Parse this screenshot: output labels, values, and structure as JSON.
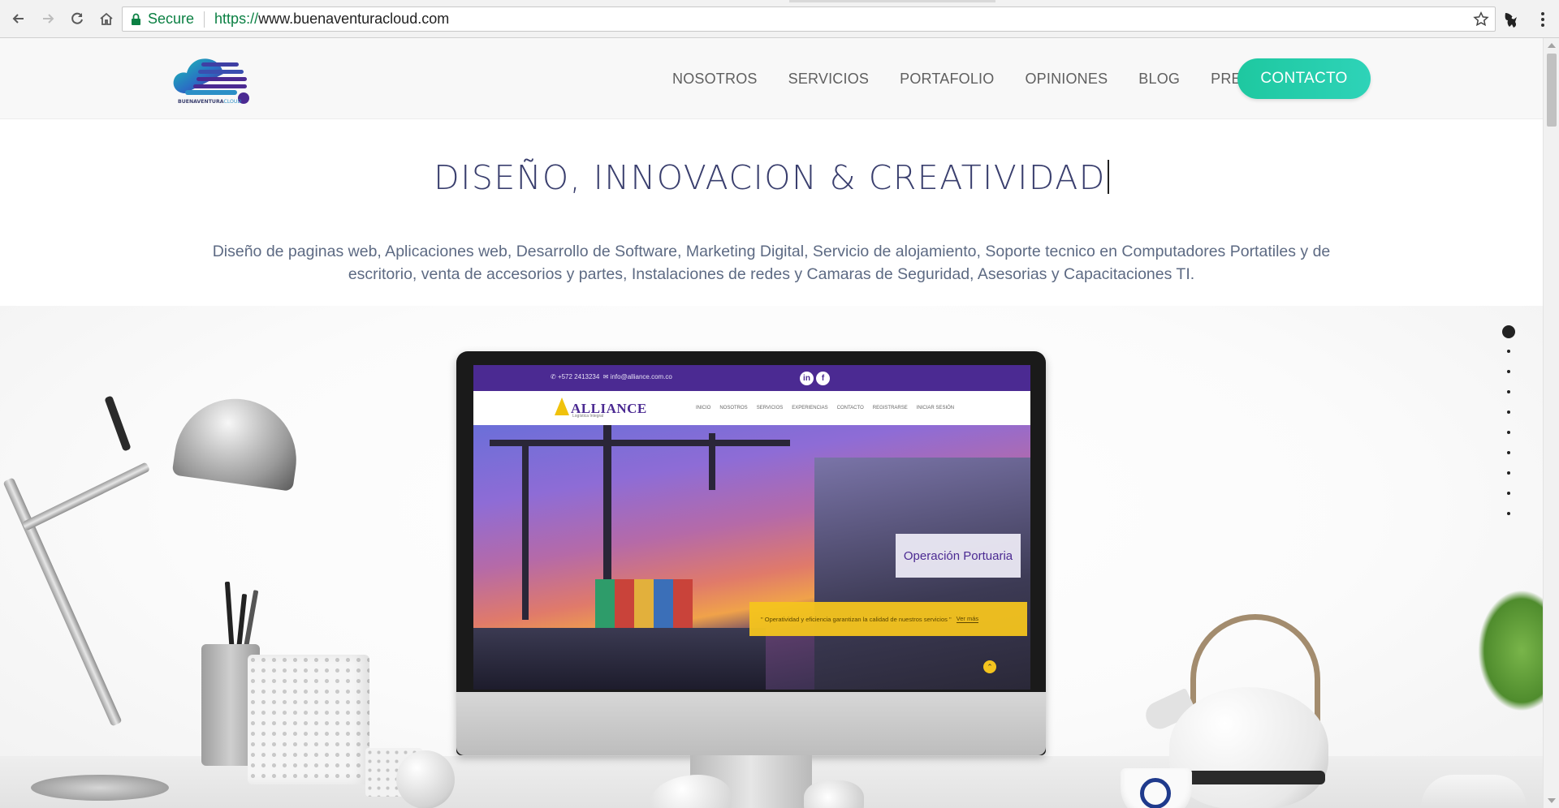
{
  "browser": {
    "secure_label": "Secure",
    "url_scheme": "https://",
    "url_rest": "www.buenaventuracloud.com",
    "icons": [
      "back-arrow-icon",
      "forward-arrow-icon",
      "reload-icon",
      "home-icon",
      "lock-icon",
      "star-icon",
      "extension-icon",
      "menu-icon"
    ]
  },
  "header": {
    "logo_text": "BUENAVENTURACLOUD",
    "nav": [
      "NOSOTROS",
      "SERVICIOS",
      "PORTAFOLIO",
      "OPINIONES",
      "BLOG",
      "PRECIOS"
    ],
    "contact_label": "CONTACTO",
    "accent_color": "#26cdae"
  },
  "hero": {
    "title": "DISEÑO, INNOVACION & CREATIVIDAD",
    "subtitle": "Diseño de paginas web, Aplicaciones web, Desarrollo de Software, Marketing Digital, Servicio de alojamiento, Soporte tecnico en Computadores Portatiles y de escritorio, venta de accesorios y partes, Instalaciones de redes y Camaras de Seguridad, Asesorias y Capacitaciones TI."
  },
  "monitor_screen": {
    "topbar_phone": "+572 2413234",
    "topbar_email": "info@alliance.com.co",
    "social": [
      "in",
      "f"
    ],
    "brand": "ALLIANCE",
    "brand_sub": "Logística Integral",
    "nav": [
      "INICIO",
      "NOSOTROS",
      "SERVICIOS",
      "EXPERIENCIAS",
      "CONTACTO",
      "REGISTRARSE",
      "INICIAR SESIÓN"
    ],
    "overlay_title": "Operación Portuaria",
    "quote": "\" Operatividad y eficiencia garantizan la calidad de nuestros servicios \"",
    "quote_link": "Ver más",
    "accent_color": "#4b2a92"
  },
  "slider": {
    "total_slides": 10,
    "active_index": 0
  }
}
